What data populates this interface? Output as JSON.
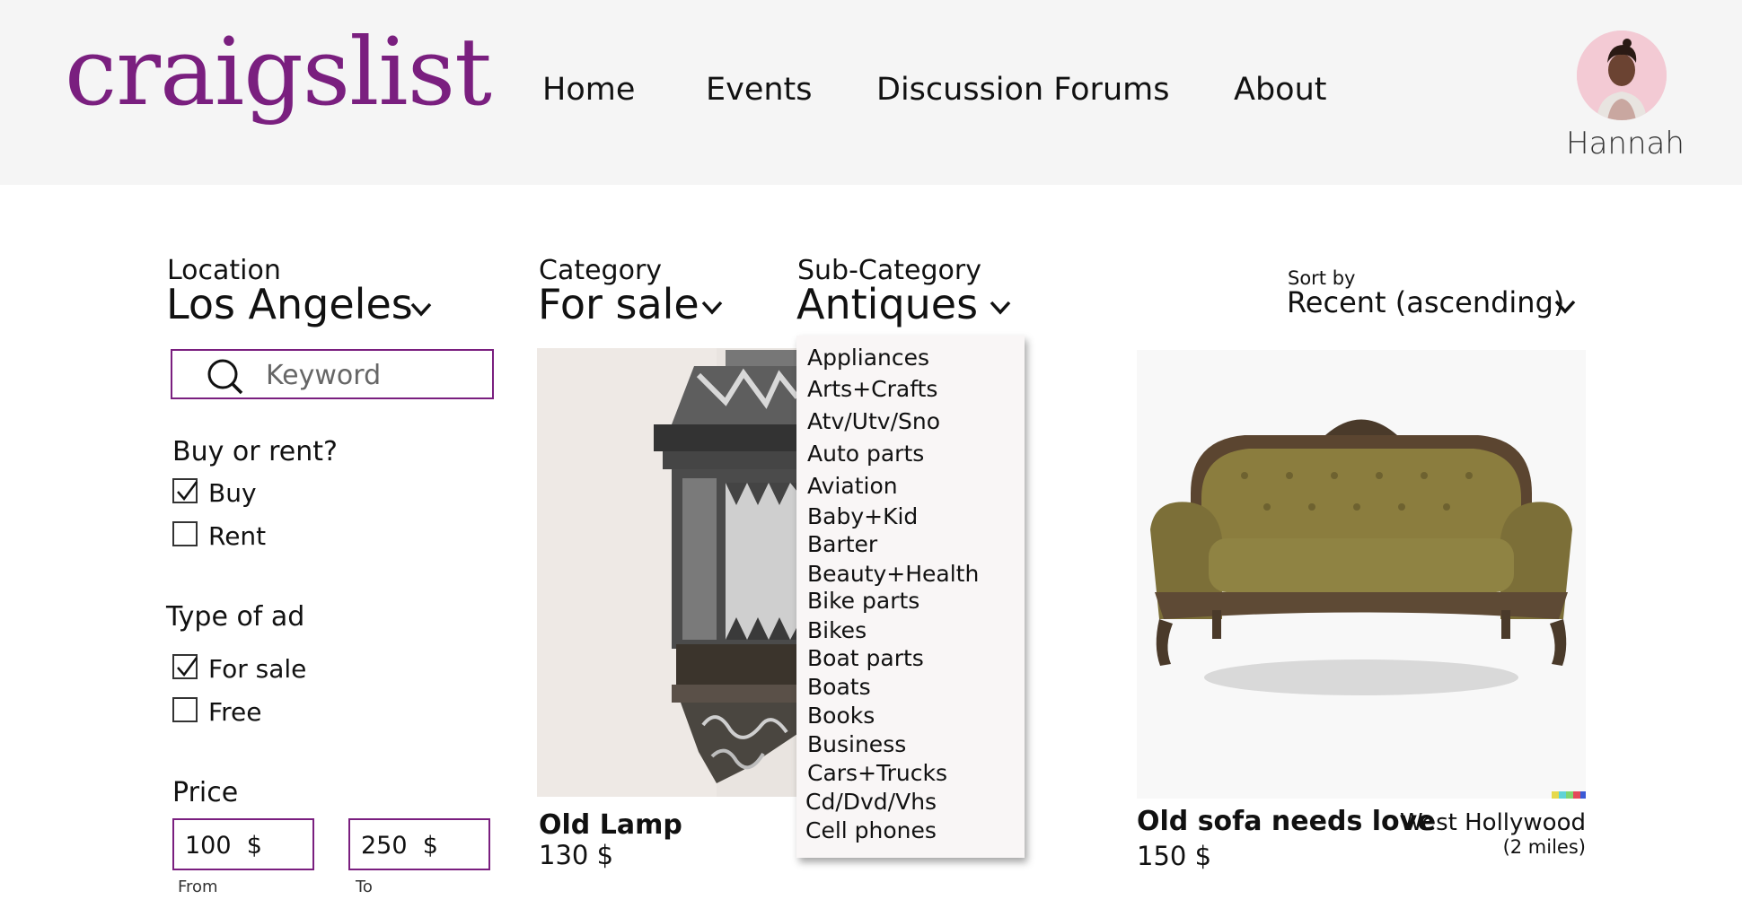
{
  "header": {
    "logo": "craigslist",
    "nav": [
      "Home",
      "Events",
      "Discussion Forums",
      "About"
    ],
    "user_name": "Hannah"
  },
  "filters": {
    "location_label": "Location",
    "location_value": "Los Angeles",
    "category_label": "Category",
    "category_value": "For sale",
    "subcategory_label": "Sub-Category",
    "subcategory_value": "Antiques",
    "sort_label": "Sort by",
    "sort_value": "Recent (ascending)",
    "search_placeholder": "Keyword",
    "buy_or_rent_title": "Buy or rent?",
    "buy_label": "Buy",
    "buy_checked": true,
    "rent_label": "Rent",
    "rent_checked": false,
    "type_title": "Type of ad",
    "for_sale_label": "For sale",
    "for_sale_checked": true,
    "free_label": "Free",
    "free_checked": false,
    "price_title": "Price",
    "price_from": "100  $",
    "price_to": "250  $",
    "from_label": "From",
    "to_label": "To"
  },
  "subcategory_dropdown": [
    "Appliances",
    "Arts+Crafts",
    "Atv/Utv/Sno",
    "Auto parts",
    "Aviation",
    "Baby+Kid",
    "Barter",
    "Beauty+Health",
    "Bike parts",
    "Bikes",
    "Boat parts",
    "Boats",
    "Books",
    "Business",
    "Cars+Trucks",
    "Cd/Dvd/Vhs",
    "Cell phones"
  ],
  "listings": [
    {
      "title": "Old Lamp",
      "price": "130 $"
    },
    {
      "title": "Old sofa needs love",
      "price": "150 $",
      "location": "West Hollywood",
      "distance": "(2 miles)"
    }
  ],
  "colors": {
    "brand": "#7a1f7f",
    "header_bg": "#f5f5f5"
  }
}
